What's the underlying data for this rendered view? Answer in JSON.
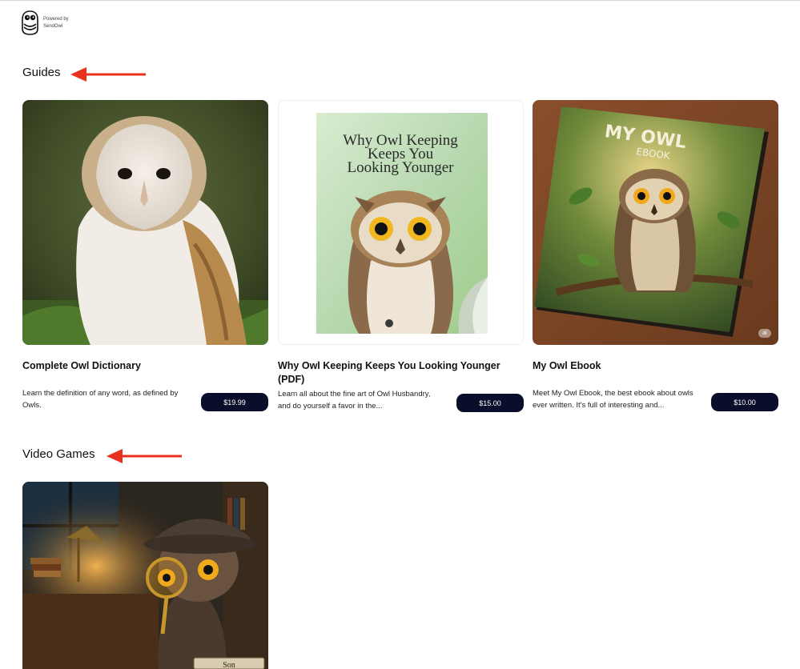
{
  "brand": {
    "powered_line1": "Powered by",
    "powered_line2": "SendOwl"
  },
  "sections": [
    {
      "title": "Guides",
      "products": [
        {
          "title": "Complete Owl Dictionary",
          "description": "Learn the definition of any word, as defined by Owls.",
          "price": "$19.99",
          "image": "barn-owl-photo"
        },
        {
          "title": "Why Owl Keeping Keeps You Looking Younger (PDF)",
          "description": "Learn all about the fine art of Owl Husbandry, and do yourself a favor in the...",
          "price": "$15.00",
          "image": "owl-guide-cover",
          "cover_title_line1": "Why Owl Keeping",
          "cover_title_line2": "Keeps You",
          "cover_title_line3": "Looking Younger"
        },
        {
          "title": "My Owl Ebook",
          "description": "Meet My Owl Ebook, the best ebook about owls ever written. It's full of interesting and...",
          "price": "$10.00",
          "image": "owl-ebook-cover",
          "cover_title_line1": "MY OWL",
          "cover_title_line2": "EBOOK",
          "badge": "ai"
        }
      ]
    },
    {
      "title": "Video Games",
      "products": [
        {
          "image": "detective-owl-game",
          "plaque_text": "Son"
        }
      ]
    }
  ],
  "colors": {
    "price_button_bg": "#0b0e2a",
    "annotation_arrow": "#e8321e"
  }
}
